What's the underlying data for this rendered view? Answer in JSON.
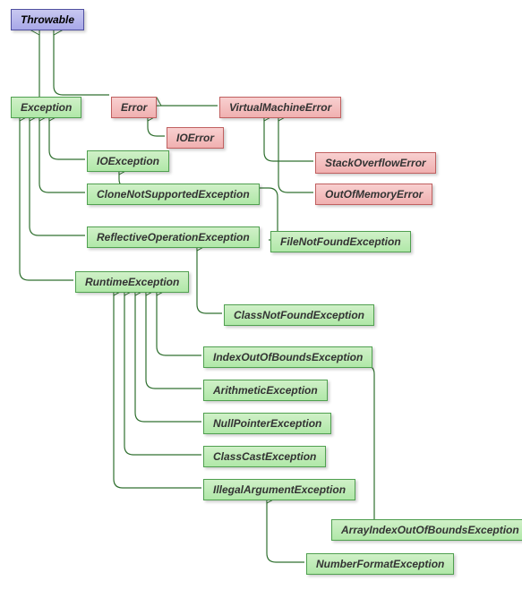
{
  "nodes": {
    "throwable": "Throwable",
    "exception": "Exception",
    "error": "Error",
    "vmerror": "VirtualMachineError",
    "ioerror": "IOError",
    "ioexception": "IOException",
    "stackoverflow": "StackOverflowError",
    "clonenotsupported": "CloneNotSupportedException",
    "outofmemory": "OutOfMemoryError",
    "reflectiveop": "ReflectiveOperationException",
    "filenotfound": "FileNotFoundException",
    "runtime": "RuntimeException",
    "classnotfound": "ClassNotFoundException",
    "indexoutofbounds": "IndexOutOfBoundsException",
    "arithmetic": "ArithmeticException",
    "nullpointer": "NullPointerException",
    "classcast": "ClassCastException",
    "illegalargument": "IllegalArgumentException",
    "arrayindex": "ArrayIndexOutOfBoundsException",
    "numberformat": "NumberFormatException"
  },
  "colors": {
    "root_bg": "#b8b8e8",
    "error_bg": "#f0b8b8",
    "exception_bg": "#b8e8b0",
    "connector": "#307030"
  },
  "hierarchy": [
    {
      "child": "Exception",
      "parent": "Throwable"
    },
    {
      "child": "Error",
      "parent": "Throwable"
    },
    {
      "child": "VirtualMachineError",
      "parent": "Error"
    },
    {
      "child": "IOError",
      "parent": "Error"
    },
    {
      "child": "StackOverflowError",
      "parent": "VirtualMachineError"
    },
    {
      "child": "OutOfMemoryError",
      "parent": "VirtualMachineError"
    },
    {
      "child": "IOException",
      "parent": "Exception"
    },
    {
      "child": "CloneNotSupportedException",
      "parent": "Exception"
    },
    {
      "child": "ReflectiveOperationException",
      "parent": "Exception"
    },
    {
      "child": "RuntimeException",
      "parent": "Exception"
    },
    {
      "child": "FileNotFoundException",
      "parent": "IOException"
    },
    {
      "child": "ClassNotFoundException",
      "parent": "ReflectiveOperationException"
    },
    {
      "child": "IndexOutOfBoundsException",
      "parent": "RuntimeException"
    },
    {
      "child": "ArithmeticException",
      "parent": "RuntimeException"
    },
    {
      "child": "NullPointerException",
      "parent": "RuntimeException"
    },
    {
      "child": "ClassCastException",
      "parent": "RuntimeException"
    },
    {
      "child": "IllegalArgumentException",
      "parent": "RuntimeException"
    },
    {
      "child": "ArrayIndexOutOfBoundsException",
      "parent": "IndexOutOfBoundsException"
    },
    {
      "child": "NumberFormatException",
      "parent": "IllegalArgumentException"
    }
  ]
}
